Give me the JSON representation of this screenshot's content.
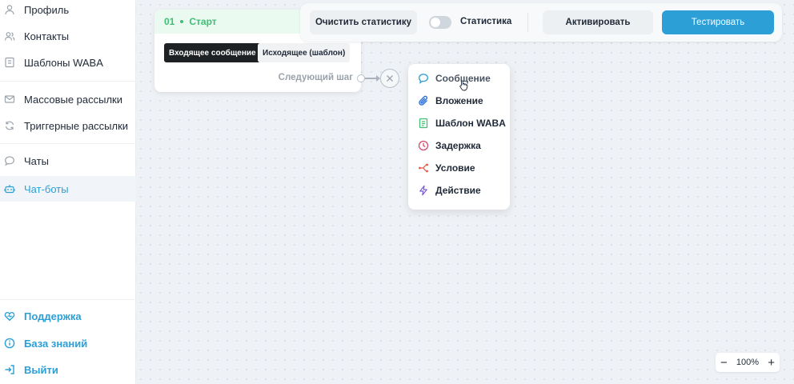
{
  "sidebar": {
    "items": [
      {
        "label": "Профиль",
        "icon": "user-icon"
      },
      {
        "label": "Контакты",
        "icon": "contacts-icon"
      },
      {
        "label": "Шаблоны WABA",
        "icon": "template-icon"
      },
      {
        "label": "Массовые рассылки",
        "icon": "mail-icon"
      },
      {
        "label": "Триггерные рассылки",
        "icon": "refresh-icon"
      },
      {
        "label": "Чаты",
        "icon": "chat-icon"
      },
      {
        "label": "Чат-боты",
        "icon": "bot-icon",
        "active": true
      }
    ],
    "bottom": [
      {
        "label": "Поддержка",
        "icon": "heart-icon"
      },
      {
        "label": "База знаний",
        "icon": "info-icon"
      },
      {
        "label": "Выйти",
        "icon": "logout-icon"
      }
    ]
  },
  "toolbar": {
    "clear_stats": "Очистить статистику",
    "stats_label": "Статистика",
    "stats_enabled": false,
    "activate": "Активировать",
    "test": "Тестировать"
  },
  "start_node": {
    "number": "01",
    "title": "Старт",
    "chip_incoming": "Входящее сообщение",
    "chip_outgoing": "Исходящее (шаблон)",
    "next_step": "Следующий шаг"
  },
  "step_menu": {
    "items": [
      {
        "label": "Сообщение",
        "icon": "message-icon",
        "color": "#2b9fd6"
      },
      {
        "label": "Вложение",
        "icon": "paperclip-icon",
        "color": "#2b6fd6"
      },
      {
        "label": "Шаблон WABA",
        "icon": "document-icon",
        "color": "#3fbf74"
      },
      {
        "label": "Задержка",
        "icon": "clock-icon",
        "color": "#d64b6f"
      },
      {
        "label": "Условие",
        "icon": "branch-icon",
        "color": "#e8533f"
      },
      {
        "label": "Действие",
        "icon": "lightning-icon",
        "color": "#7c5cd6"
      }
    ]
  },
  "zoom": {
    "minus": "−",
    "level": "100%",
    "plus": "+"
  },
  "colors": {
    "accent": "#2b9fd6",
    "start_green": "#3fbf74",
    "canvas": "#eef1f5"
  }
}
